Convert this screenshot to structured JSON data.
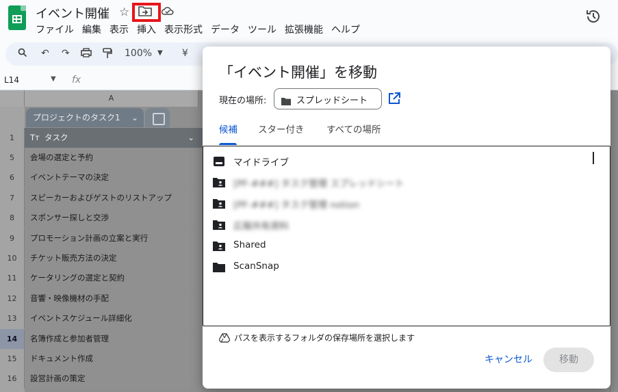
{
  "doc": {
    "title": "イベント開催"
  },
  "menubar": [
    "ファイル",
    "編集",
    "表示",
    "挿入",
    "表示形式",
    "データ",
    "ツール",
    "拡張機能",
    "ヘルプ"
  ],
  "toolbar": {
    "zoom": "100%",
    "currency": "¥"
  },
  "formula": {
    "namebox": "L14",
    "fx": "fx"
  },
  "grid": {
    "column_label": "A",
    "table_name": "プロジェクトのタスク1",
    "header_row_num": "1",
    "header_label": "タスク",
    "header_prefix": "Tт",
    "rows": [
      {
        "num": "5",
        "task": "会場の選定と予約"
      },
      {
        "num": "6",
        "task": "イベントテーマの決定"
      },
      {
        "num": "7",
        "task": "スピーカーおよびゲストのリストアップ"
      },
      {
        "num": "8",
        "task": "スポンサー探しと交渉"
      },
      {
        "num": "9",
        "task": "プロモーション計画の立案と実行"
      },
      {
        "num": "10",
        "task": "チケット販売方法の決定"
      },
      {
        "num": "11",
        "task": "ケータリングの選定と契約"
      },
      {
        "num": "12",
        "task": "音響・映像機材の手配"
      },
      {
        "num": "13",
        "task": "イベントスケジュール詳細化"
      },
      {
        "num": "14",
        "task": "名簿作成と参加者管理"
      },
      {
        "num": "15",
        "task": "ドキュメント作成"
      },
      {
        "num": "16",
        "task": "設営計画の策定"
      }
    ],
    "active_row": "14"
  },
  "dialog": {
    "title": "「イベント開催」を移動",
    "current_location_label": "現在の場所:",
    "current_location": "スプレッドシート",
    "tabs": [
      {
        "label": "候補",
        "active": true
      },
      {
        "label": "スター付き",
        "active": false
      },
      {
        "label": "すべての場所",
        "active": false
      }
    ],
    "items": [
      {
        "label": "マイドライブ",
        "icon": "drive-icon",
        "blurred": false
      },
      {
        "label": "[PF-###] タスク管理 スプレッドシート",
        "icon": "shared-folder-icon",
        "blurred": true
      },
      {
        "label": "[PF-###] タスク管理 notion",
        "icon": "shared-folder-icon",
        "blurred": true
      },
      {
        "label": "広報共有資料",
        "icon": "shared-folder-icon",
        "blurred": true
      },
      {
        "label": "Shared",
        "icon": "shared-folder-icon",
        "blurred": false
      },
      {
        "label": "ScanSnap",
        "icon": "folder-icon",
        "blurred": false
      }
    ],
    "hint": "パスを表示するフォルダの保存場所を選択します",
    "cancel_label": "キャンセル",
    "move_label": "移動"
  }
}
